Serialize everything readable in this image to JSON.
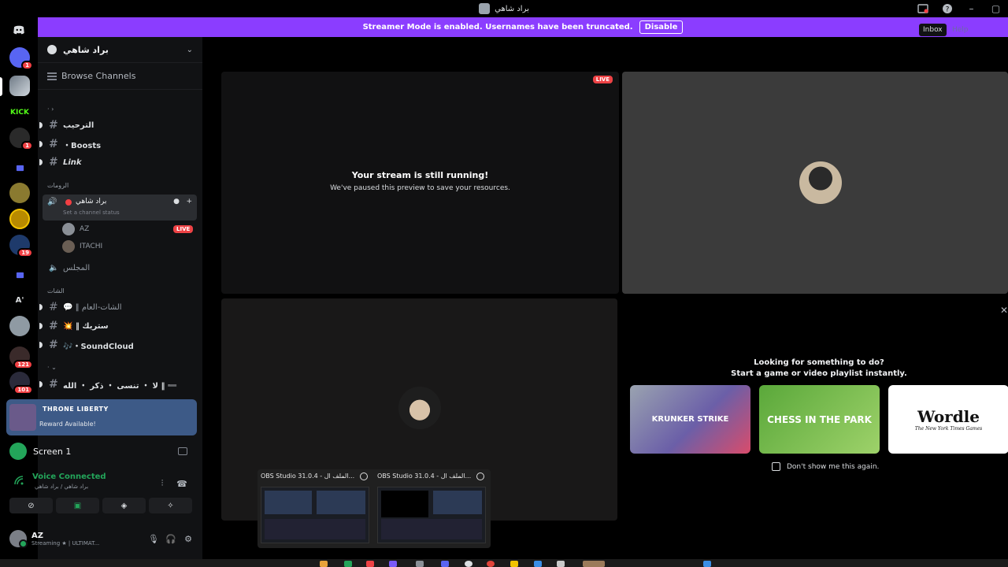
{
  "window": {
    "title": "براد شاهي"
  },
  "banner": {
    "text": "Streamer Mode is enabled. Usernames have been truncated.",
    "button": "Disable"
  },
  "tooltips": {
    "inbox": "Inbox",
    "help": "Help"
  },
  "rail": {
    "servers": [
      {
        "name": "discord-home",
        "badge": ""
      },
      {
        "name": "server-1",
        "badge": "1"
      },
      {
        "name": "server-2",
        "badge": ""
      },
      {
        "name": "kick",
        "label": "KICK",
        "badge": ""
      },
      {
        "name": "server-4",
        "badge": "1"
      },
      {
        "name": "server-5",
        "badge": ""
      },
      {
        "name": "server-6",
        "badge": ""
      },
      {
        "name": "server-7",
        "badge": ""
      },
      {
        "name": "server-8",
        "badge": "19"
      },
      {
        "name": "server-9",
        "badge": ""
      },
      {
        "name": "server-10",
        "label": "A'",
        "badge": ""
      },
      {
        "name": "server-11",
        "badge": ""
      },
      {
        "name": "server-12",
        "badge": "121"
      },
      {
        "name": "server-13",
        "badge": "101"
      }
    ]
  },
  "sidebar": {
    "guild_name": "براد شاهي",
    "browse": "Browse Channels",
    "categories": {
      "rooms": "الرومات",
      "chats": "الشات"
    },
    "channels": [
      {
        "name": "الترحيب"
      },
      {
        "name": "・Boosts"
      },
      {
        "name": "Link"
      }
    ],
    "voice_channel": {
      "name": "براد شاهي",
      "status": "Set a channel status"
    },
    "voice_users": [
      {
        "name": "AZ",
        "live": "LIVE"
      },
      {
        "name": "ITACHI"
      }
    ],
    "voice_channel_2": "المجلس",
    "chat_channels": [
      {
        "name": "💬 ‖ الشات-العام"
      },
      {
        "name": "💥 ‖ ستريك"
      },
      {
        "name": "🎶・SoundCloud"
      },
      {
        "name": "لا ・ تنسى ・ ذكر ・ الله ‖ ➖"
      }
    ]
  },
  "reward": {
    "logo": "THRONE LIBERTY",
    "text": "Reward Available!"
  },
  "screen": {
    "label": "Screen 1"
  },
  "voice": {
    "status": "Voice Connected",
    "location": "براد شاهي / براد شاهي"
  },
  "user": {
    "name": "AZ",
    "status": "Streaming ★ | ULTIMAT..."
  },
  "stage": {
    "tile1": {
      "live": "LIVE",
      "heading": "Your stream is still running!",
      "sub": "We've paused this preview to save your resources."
    },
    "activity": {
      "title_1": "Looking for something to do?",
      "title_2": "Start a game or video playlist instantly.",
      "games": [
        "KRUNKER STRIKE",
        "CHESS IN THE PARK",
        "Wordle"
      ],
      "wordle_sub": "The New York Times Games",
      "dont_show": "Don't show me this again."
    }
  },
  "thumbnails": [
    {
      "title": "OBS Studio 31.0.4 - الملف ال..."
    },
    {
      "title": "OBS Studio 31.0.4 - الملف ال..."
    }
  ],
  "colors": {
    "brand": "#5865f2",
    "streamer_banner": "#8b3dff",
    "online": "#23a55a",
    "live": "#ed4245"
  }
}
